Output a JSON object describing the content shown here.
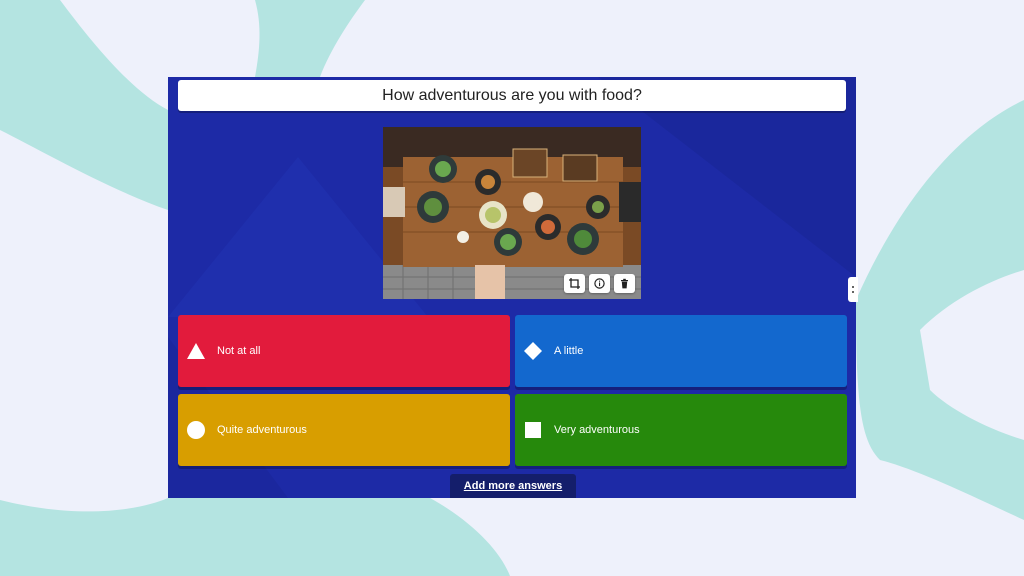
{
  "question": {
    "text": "How adventurous are you with food?"
  },
  "media": {
    "alt_icon": "food-table-photo",
    "tools": [
      {
        "icon": "crop-icon"
      },
      {
        "icon": "info-icon"
      },
      {
        "icon": "trash-icon"
      }
    ]
  },
  "answers": [
    {
      "label": "Not at all",
      "shape": "triangle",
      "color": "#e21b3c"
    },
    {
      "label": "A little",
      "shape": "diamond",
      "color": "#1368ce"
    },
    {
      "label": "Quite adventurous",
      "shape": "circle",
      "color": "#d89e00"
    },
    {
      "label": "Very adventurous",
      "shape": "square",
      "color": "#26890c"
    }
  ],
  "add_more": {
    "label": "Add more answers"
  },
  "colors": {
    "page_bg": "#eef1fb",
    "blob": "#b4e4e1",
    "editor_bg": "#1d2aa6"
  }
}
